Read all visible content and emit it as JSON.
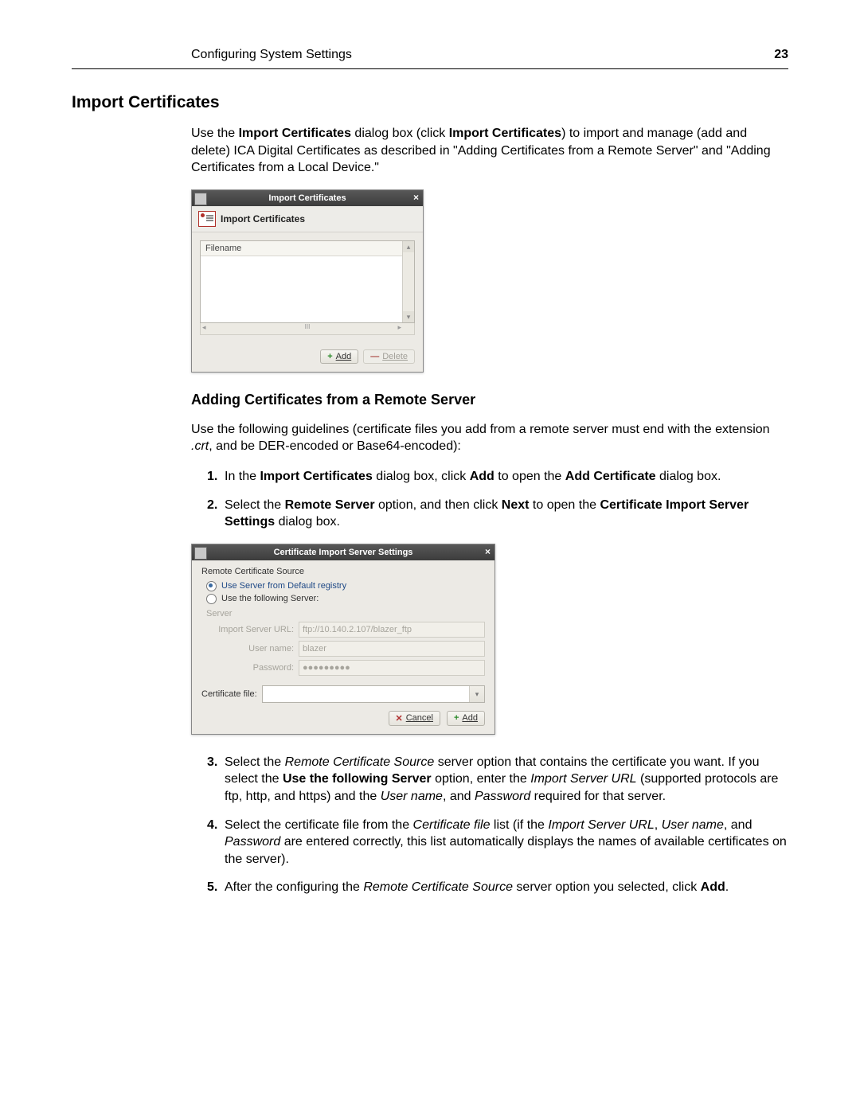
{
  "header": {
    "section": "Configuring System Settings",
    "page": "23"
  },
  "h1": "Import Certificates",
  "intro": {
    "text": "Use the ",
    "b1": "Import Certificates",
    "t2": " dialog box (click ",
    "b2": "Import Certificates",
    "t3": ") to import and manage (add and delete) ICA Digital Certificates as described in \"Adding Certificates from a Remote Server\" and \"Adding Certificates from a Local Device.\""
  },
  "dlg1": {
    "title": "Import Certificates",
    "subtitle": "Import Certificates",
    "col": "Filename",
    "add": "Add",
    "delete": "Delete",
    "hscroll_label": "III"
  },
  "h2": "Adding Certificates from a Remote Server",
  "p2": {
    "t1": "Use the following guidelines (certificate files you add from a remote server must end with the extension ",
    "i1": ".crt",
    "t2": ", and be DER-encoded or Base64-encoded):"
  },
  "steps1": {
    "s1": {
      "t1": "In the ",
      "b1": "Import Certificates",
      "t2": " dialog box, click ",
      "b2": "Add",
      "t3": " to open the ",
      "b3": "Add Certificate",
      "t4": " dialog box."
    },
    "s2": {
      "t1": "Select the ",
      "b1": "Remote Server",
      "t2": " option, and then click ",
      "b2": "Next",
      "t3": " to open the ",
      "b3": "Certificate Import Server Settings",
      "t4": " dialog box."
    }
  },
  "dlg2": {
    "title": "Certificate Import Server Settings",
    "group": "Remote Certificate Source",
    "opt1": "Use Server from Default registry",
    "opt2": "Use the following Server:",
    "server_label": "Server",
    "url_label": "Import Server URL:",
    "url_val": "ftp://10.140.2.107/blazer_ftp",
    "user_label": "User name:",
    "user_val": "blazer",
    "pass_label": "Password:",
    "pass_val": "●●●●●●●●●",
    "certfile_label": "Certificate file:",
    "cancel": "Cancel",
    "add": "Add"
  },
  "steps2": {
    "s3": {
      "t1": "Select the ",
      "i1": "Remote Certificate Source",
      "t2": " server option that contains the certificate you want. If you select the ",
      "b1": "Use the following Server",
      "t3": " option, enter the ",
      "i2": "Import Server URL",
      "t4": " (supported protocols are ftp, http, and https) and the ",
      "i3": "User name",
      "t5": ", and ",
      "i4": "Password",
      "t6": " required for that server."
    },
    "s4": {
      "t1": "Select the certificate file from the ",
      "i1": "Certificate file",
      "t2": " list (if the ",
      "i2": "Import Server URL",
      "t3": ", ",
      "i3": "User name",
      "t4": ", and ",
      "i4": "Password",
      "t5": " are entered correctly, this list automatically displays the names of available certificates on the server)."
    },
    "s5": {
      "t1": "After the configuring the ",
      "i1": "Remote Certificate Source",
      "t2": " server option you selected, click ",
      "b1": "Add",
      "t3": "."
    }
  }
}
